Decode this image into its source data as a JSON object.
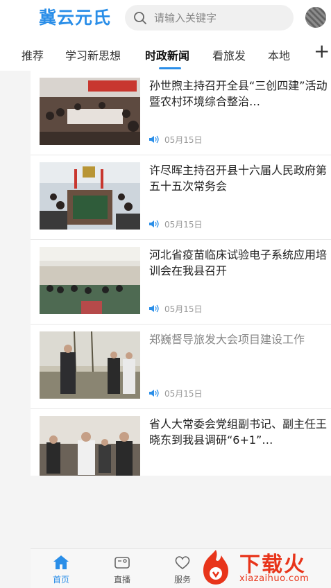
{
  "header": {
    "logo": "冀云元氏",
    "search_placeholder": "请输入关键字"
  },
  "tabs": [
    {
      "label": "推荐",
      "visible_text": "推荐"
    },
    {
      "label": "学习新思想"
    },
    {
      "label": "时政新闻",
      "active": true
    },
    {
      "label": "看旅发"
    },
    {
      "label": "本地"
    }
  ],
  "articles": [
    {
      "title": "孙世煦主持召开全县“三创四建”活动暨农村环境综合整治…",
      "date": "05月15日",
      "read": false
    },
    {
      "title": "许尽晖主持召开县十六届人民政府第五十五次常务会",
      "date": "05月15日",
      "read": false
    },
    {
      "title": "河北省疫苗临床试验电子系统应用培训会在我县召开",
      "date": "05月15日",
      "read": false
    },
    {
      "title": "郑巍督导旅发大会项目建设工作",
      "date": "05月15日",
      "read": true
    },
    {
      "title": "省人大常委会党组副书记、副主任王晓东到我县调研“6+1”…",
      "date": "",
      "read": false
    }
  ],
  "bottom_nav": [
    {
      "label": "首页",
      "icon": "home-icon",
      "active": true
    },
    {
      "label": "直播",
      "icon": "camera-icon"
    },
    {
      "label": "服务",
      "icon": "heart-icon"
    }
  ],
  "watermark": {
    "text": "下载火",
    "sub": "xiazaihuo.com"
  },
  "colors": {
    "accent": "#2a8ee8",
    "watermark": "#e8341a"
  }
}
